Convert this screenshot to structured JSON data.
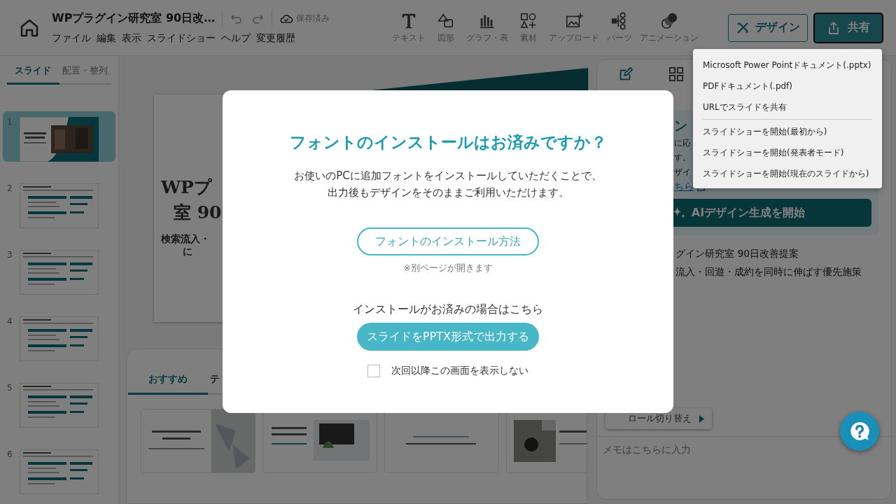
{
  "header": {
    "title": "WPプラグイン研究室 90日改…",
    "save_status": "保存済み",
    "menu": [
      "ファイル",
      "編集",
      "表示",
      "スライドショー",
      "ヘルプ",
      "変更履歴"
    ],
    "tools": [
      {
        "kind": "text",
        "label": "テキスト"
      },
      {
        "kind": "shape",
        "label": "図形"
      },
      {
        "kind": "chart",
        "label": "グラフ・表"
      },
      {
        "kind": "material",
        "label": "素材"
      },
      {
        "kind": "upload",
        "label": "アップロード"
      },
      {
        "kind": "parts",
        "label": "パーツ"
      },
      {
        "kind": "animation",
        "label": "アニメーション"
      }
    ],
    "design_button": "デザイン",
    "share_button": "共有"
  },
  "share_menu": {
    "groups": [
      [
        "Microsoft Power Pointドキュメント(.pptx)",
        "PDFドキュメント(.pdf)",
        "URLでスライドを共有"
      ],
      [
        "スライドショーを開始(最初から)",
        "スライドショーを開始(発表者モード)",
        "スライドショーを開始(現在のスライドから)"
      ]
    ]
  },
  "sidebar": {
    "tabs": [
      {
        "label": "スライド",
        "selected": true
      },
      {
        "label": "配置・整列",
        "selected": false
      }
    ],
    "slides": [
      {
        "number": "1",
        "selected": true
      },
      {
        "number": "2",
        "selected": false
      },
      {
        "number": "3",
        "selected": false
      },
      {
        "number": "4",
        "selected": false
      },
      {
        "number": "5",
        "selected": false
      },
      {
        "number": "6",
        "selected": false
      }
    ]
  },
  "canvas": {
    "title_lines": [
      "WPプ",
      "室 90"
    ],
    "subtitle_lines": [
      "検索流入・",
      "に"
    ]
  },
  "templates": {
    "tabs": [
      {
        "label": "おすすめ",
        "selected": true
      },
      {
        "label": "テ",
        "selected": false
      }
    ]
  },
  "right_panel": {
    "ai_card": {
      "heading": "ン",
      "lines": [
        "に応",
        "す。",
        "ザイ"
      ],
      "link": "ちら",
      "button": "AIデザイン生成を開始"
    },
    "slide_text": [
      "グイン研究室 90日改善提案",
      "流入・回遊・成約を同時に伸ばす優先施策"
    ],
    "scroll_toggle": "ロール切り替え",
    "memo": {
      "placeholder": "メモはこちらに入力"
    }
  },
  "dialog": {
    "title": "フォントのインストールはお済みですか？",
    "description_lines": [
      "お使いのPCに追加フォントをインストールしていただくことで、",
      "出力後もデザインをそのままご利用いただけます。"
    ],
    "guide_button": "フォントのインストール方法",
    "guide_note": "※別ページが開きます",
    "installed_text": "インストールがお済みの場合はこちら",
    "export_button": "スライドをPPTX形式で出力する",
    "dont_show_again": {
      "label": "次回以降この画面を表示しない",
      "checked": false
    }
  }
}
